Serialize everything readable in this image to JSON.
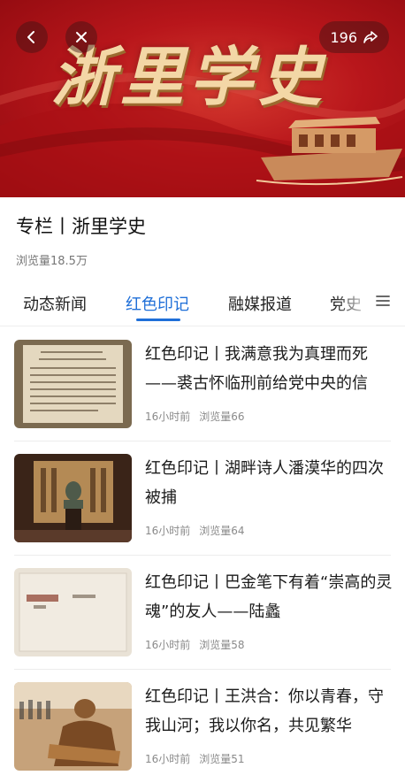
{
  "banner": {
    "title": "浙里学史",
    "share_count": "196"
  },
  "column": {
    "title": "专栏丨浙里学史",
    "views": "浏览量18.5万"
  },
  "tabs": [
    {
      "label": "动态新闻",
      "active": false
    },
    {
      "label": "红色印记",
      "active": true
    },
    {
      "label": "融媒报道",
      "active": false
    },
    {
      "label": "党史",
      "active": false
    }
  ],
  "articles": [
    {
      "title": "红色印记丨我满意我为真理而死——裘古怀临刑前给党中央的信",
      "time": "16小时前",
      "views": "浏览量66",
      "thumb": "document"
    },
    {
      "title": "红色印记丨湖畔诗人潘漠华的四次被捕",
      "time": "16小时前",
      "views": "浏览量64",
      "thumb": "bust"
    },
    {
      "title": "红色印记丨巴金笔下有着“崇高的灵魂”的友人——陆蠡",
      "time": "16小时前",
      "views": "浏览量58",
      "thumb": "book"
    },
    {
      "title": "红色印记丨王洪合：你以青春，守我山河；我以你名，共见繁华",
      "time": "16小时前",
      "views": "浏览量51",
      "thumb": "statue"
    }
  ],
  "colors": {
    "accent": "#1f6fd8",
    "banner_red": "#b8161b"
  }
}
